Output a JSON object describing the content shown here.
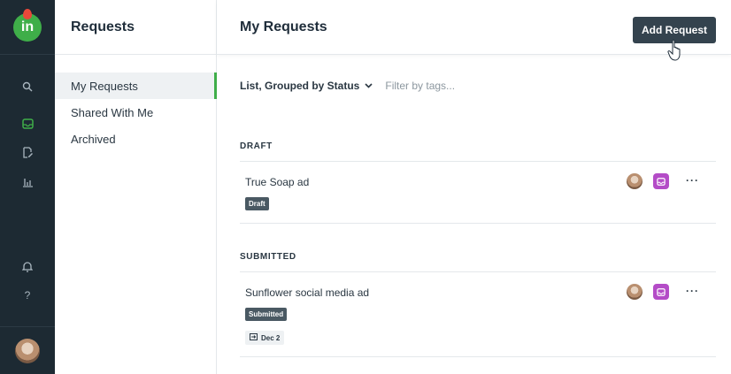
{
  "app": {
    "logo_text": "in",
    "brand_color": "#3fae49",
    "accent_alert": "#e8483a",
    "rail_bg": "#1d2a33"
  },
  "rail": {
    "icons": [
      "search-icon",
      "inbox-icon",
      "document-edit-icon",
      "bar-chart-icon",
      "bell-icon",
      "help-icon"
    ],
    "help_label": "?"
  },
  "sidebar": {
    "title": "Requests",
    "items": [
      {
        "label": "My Requests",
        "active": true
      },
      {
        "label": "Shared With Me",
        "active": false
      },
      {
        "label": "Archived",
        "active": false
      }
    ]
  },
  "main": {
    "title": "My Requests",
    "add_button_label": "Add Request",
    "view_select_label": "List, Grouped by Status",
    "tag_filter_placeholder": "Filter by tags...",
    "groups": [
      {
        "label": "DRAFT",
        "requests": [
          {
            "title": "True Soap ad",
            "status_badge": "Draft",
            "more": "···"
          }
        ]
      },
      {
        "label": "SUBMITTED",
        "requests": [
          {
            "title": "Sunflower social media ad",
            "status_badge": "Submitted",
            "due": "Dec 2",
            "more": "···"
          }
        ]
      }
    ]
  }
}
